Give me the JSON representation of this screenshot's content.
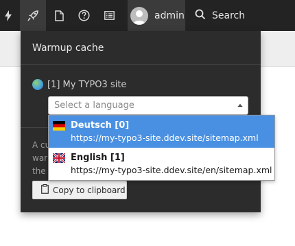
{
  "toolbar": {
    "icons": [
      "bolt-icon",
      "rocket-icon",
      "file-icon",
      "help-icon",
      "list-icon"
    ],
    "user": {
      "name": "admin"
    },
    "search": {
      "label": "Search"
    }
  },
  "panel": {
    "title": "Warmup cache",
    "site_label": "[1] My TYPO3 site",
    "select": {
      "placeholder": "Select a language",
      "options": [
        {
          "name": "Deutsch [0]",
          "url": "https://my-typo3-site.ddev.site/sitemap.xml",
          "flag": "germany-flag",
          "selected": true
        },
        {
          "name": "English [1]",
          "url": "https://my-typo3-site.ddev.site/en/sitemap.xml",
          "flag": "uk-flag",
          "selected": false
        }
      ]
    },
    "description_lines": [
      "A cu",
      "war",
      "the"
    ],
    "copy_button_label": "Copy to clipboard"
  },
  "colors": {
    "toolbar_bg": "#232323",
    "panel_bg": "#2c2c2c",
    "selected_option": "#4a90e2"
  }
}
